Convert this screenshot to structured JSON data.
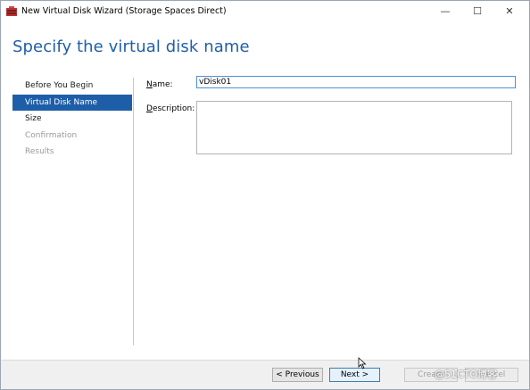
{
  "window": {
    "title": "New Virtual Disk Wizard (Storage Spaces Direct)",
    "minimize_glyph": "—",
    "maximize_glyph": "☐",
    "close_glyph": "✕"
  },
  "page": {
    "title": "Specify the virtual disk name"
  },
  "nav": {
    "items": [
      {
        "label": "Before You Begin",
        "state": "normal"
      },
      {
        "label": "Virtual Disk Name",
        "state": "active"
      },
      {
        "label": "Size",
        "state": "normal"
      },
      {
        "label": "Confirmation",
        "state": "disabled"
      },
      {
        "label": "Results",
        "state": "disabled"
      }
    ]
  },
  "form": {
    "name_label_prefix": "N",
    "name_label_rest": "ame:",
    "name_value": "vDisk01",
    "description_label_prefix": "D",
    "description_label_rest": "escription:",
    "description_value": ""
  },
  "footer": {
    "previous_label": "< Previous",
    "next_label": "Next >",
    "create_label": "Create",
    "cancel_label": "Cancel"
  },
  "watermark": "@51CTO博客",
  "colors": {
    "accent": "#1e5ea8",
    "title_blue": "#1f5fa8",
    "footer_bg": "#f0f0f0"
  },
  "icons": {
    "app": "storage-app-icon",
    "cursor": "mouse-pointer-icon"
  }
}
